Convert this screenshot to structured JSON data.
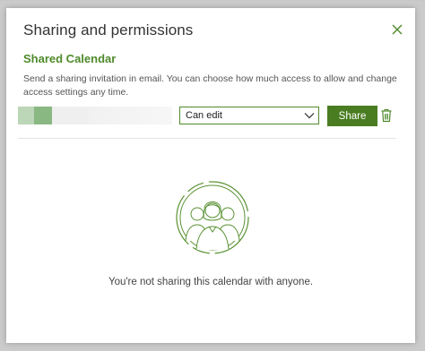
{
  "dialog": {
    "title": "Sharing and permissions",
    "close_icon": "close-icon"
  },
  "section": {
    "heading": "Shared Calendar",
    "description": "Send a sharing invitation in email. You can choose how much access to allow and change access settings any time."
  },
  "invite": {
    "recipient_value": "",
    "permission": {
      "selected": "Can edit"
    },
    "share_label": "Share",
    "delete_icon": "trash-icon"
  },
  "empty_state": {
    "icon": "people-group-icon",
    "message": "You're not sharing this calendar with anyone."
  },
  "colors": {
    "accent": "#4a7d22",
    "heading": "#4e8a2a",
    "backdrop": "#cbcbcb"
  }
}
